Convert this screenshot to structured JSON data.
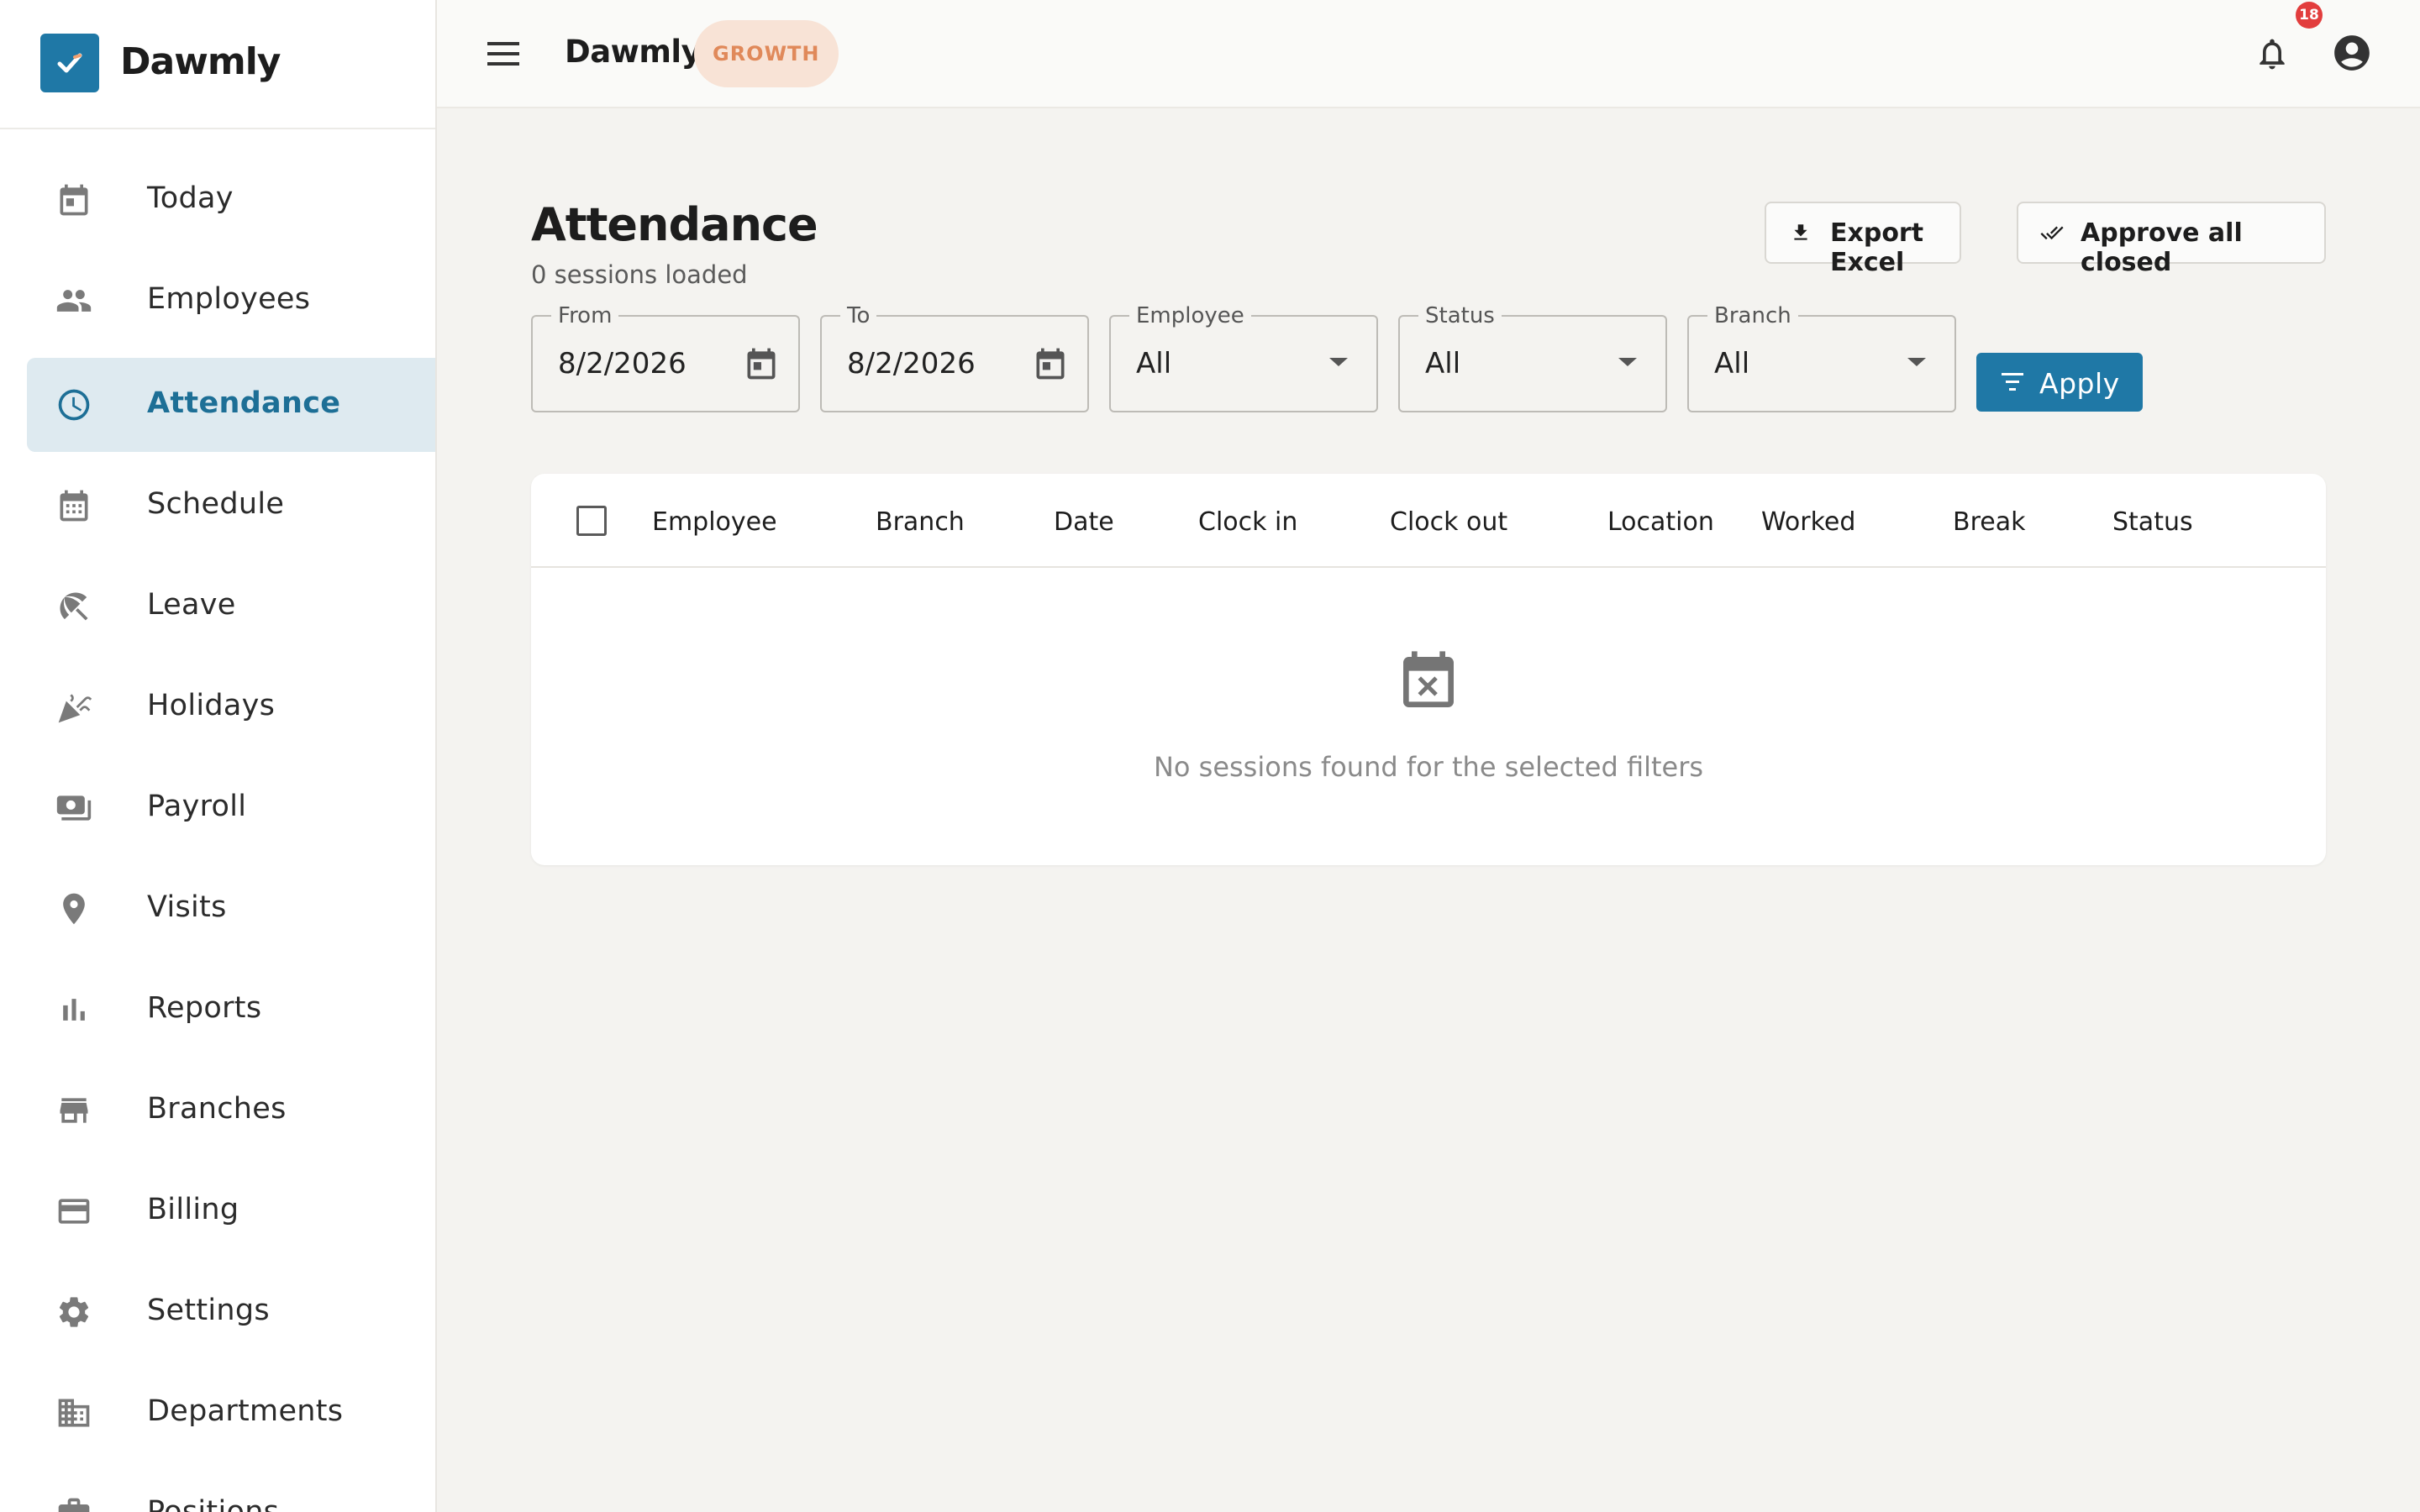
{
  "app": {
    "brand": "Dawmly",
    "title": "Dawmly",
    "plan_badge": "GROWTH",
    "notification_count": "18"
  },
  "sidebar": {
    "items": [
      {
        "label": "Today",
        "icon": "calendar-today-icon",
        "active": false
      },
      {
        "label": "Employees",
        "icon": "people-icon",
        "active": false
      },
      {
        "label": "Attendance",
        "icon": "clock-icon",
        "active": true
      },
      {
        "label": "Schedule",
        "icon": "calendar-month-icon",
        "active": false
      },
      {
        "label": "Leave",
        "icon": "beach-umbrella-icon",
        "active": false
      },
      {
        "label": "Holidays",
        "icon": "celebration-icon",
        "active": false
      },
      {
        "label": "Payroll",
        "icon": "payments-icon",
        "active": false
      },
      {
        "label": "Visits",
        "icon": "location-pin-icon",
        "active": false
      },
      {
        "label": "Reports",
        "icon": "bar-chart-icon",
        "active": false
      },
      {
        "label": "Branches",
        "icon": "store-icon",
        "active": false
      },
      {
        "label": "Billing",
        "icon": "credit-card-icon",
        "active": false
      },
      {
        "label": "Settings",
        "icon": "gear-icon",
        "active": false
      },
      {
        "label": "Departments",
        "icon": "domain-icon",
        "active": false
      },
      {
        "label": "Positions",
        "icon": "briefcase-icon",
        "active": false
      }
    ]
  },
  "page": {
    "title": "Attendance",
    "subtitle": "0 sessions loaded",
    "export_label": "Export Excel",
    "approve_label": "Approve all closed"
  },
  "filters": {
    "from": {
      "label": "From",
      "value": "8/2/2026"
    },
    "to": {
      "label": "To",
      "value": "8/2/2026"
    },
    "employee": {
      "label": "Employee",
      "value": "All"
    },
    "status": {
      "label": "Status",
      "value": "All"
    },
    "branch": {
      "label": "Branch",
      "value": "All"
    },
    "apply_label": "Apply"
  },
  "table": {
    "columns": [
      "Employee",
      "Branch",
      "Date",
      "Clock in",
      "Clock out",
      "Location",
      "Worked",
      "Break",
      "Status"
    ],
    "rows": [],
    "empty_message": "No sessions found for the selected filters"
  },
  "colors": {
    "primary": "#1f78a6",
    "active_bg": "#deeaf0",
    "badge_bg": "#f8e3d6",
    "badge_text": "#e0895a",
    "notif": "#e23d3d"
  }
}
